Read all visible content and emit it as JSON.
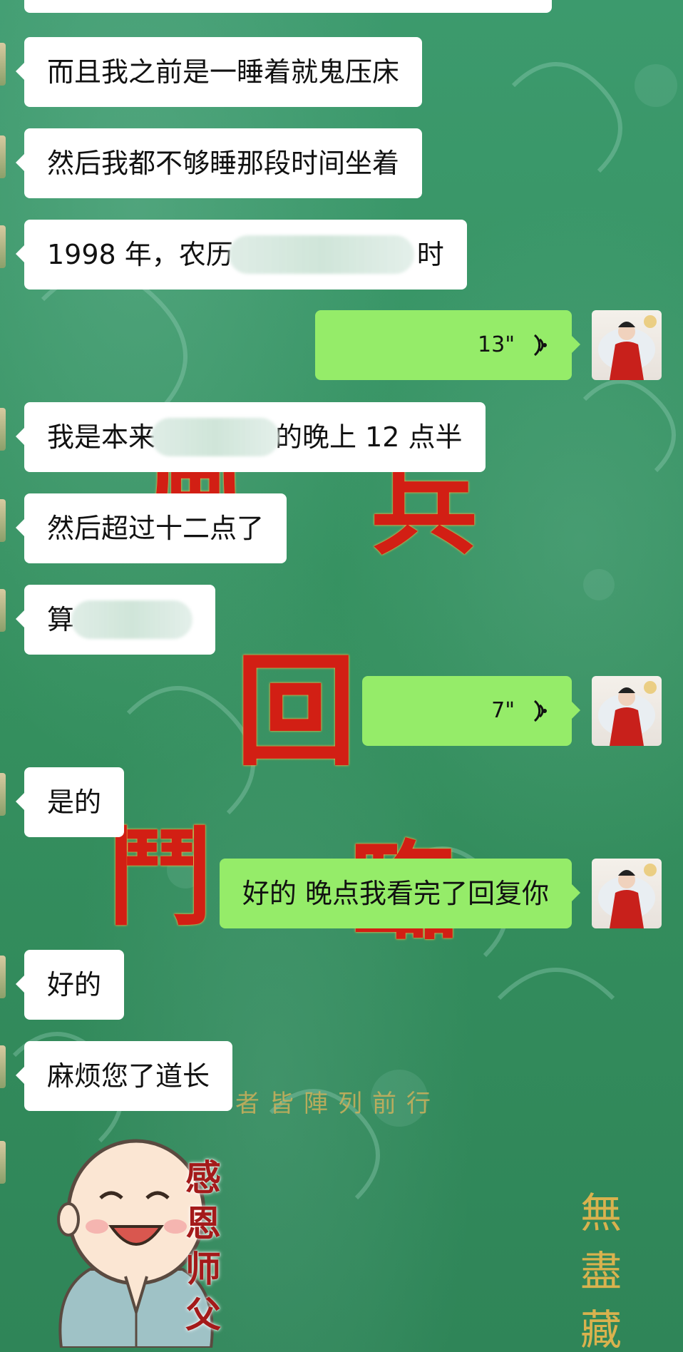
{
  "messages": [
    {
      "side": "in",
      "text": "而且我之前是一睡着就鬼压床"
    },
    {
      "side": "in",
      "text": "然后我都不够睡那段时间坐着"
    },
    {
      "side": "in",
      "text_before": "1998 年，农历",
      "text_after": "时",
      "redacted": true
    },
    {
      "side": "out",
      "type": "voice",
      "duration": "13\""
    },
    {
      "side": "in",
      "text_before": "我是本来",
      "text_after": "的晚上 12 点半",
      "redacted": true
    },
    {
      "side": "in",
      "text": "然后超过十二点了"
    },
    {
      "side": "in",
      "text_before": "算",
      "text_after": "",
      "redacted": true
    },
    {
      "side": "out",
      "type": "voice",
      "duration": "7\""
    },
    {
      "side": "in",
      "text": "是的"
    },
    {
      "side": "out",
      "text": "好的 晚点我看完了回复你"
    },
    {
      "side": "in",
      "text": "好的"
    },
    {
      "side": "in",
      "text": "麻烦您了道长"
    }
  ],
  "sticker": {
    "caption": "感恩师父"
  },
  "background": {
    "motto": "者皆陣列前行",
    "seal": "無盡藏",
    "colors": {
      "bg": "#3a9468",
      "incoming": "#ffffff",
      "outgoing": "#95ec69",
      "red": "#d21f14",
      "gold": "#d6b25a"
    }
  },
  "icons": {
    "voice": "voice-wave-icon",
    "avatar": "avatar-icon"
  }
}
